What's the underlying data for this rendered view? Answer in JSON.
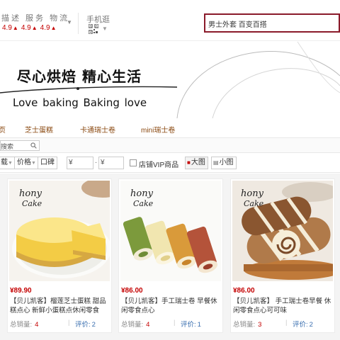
{
  "header": {
    "rating_label": "描述 服务 物流",
    "rating_values": [
      "4.9",
      "4.9",
      "4.9"
    ],
    "mobile_label": "手机逛",
    "search_value": "男士外套 百变百搭"
  },
  "banner": {
    "slogan_cn": "尽心烘焙 精心生活",
    "slogan_en": "Love baking   Baking love"
  },
  "category_nav": [
    "页",
    "芝士蛋糕",
    "卡通瑞士卷",
    "mini瑞士卷"
  ],
  "shop_search": {
    "text": "搜索"
  },
  "sortbar": {
    "sort_sales": "载",
    "sort_price": "价格",
    "sort_reputation": "口碑",
    "price_from": "¥",
    "price_dash": "-",
    "price_to": "¥",
    "vip_label": "店铺VIP商品",
    "view_large": "大图",
    "view_small": "小图"
  },
  "products": [
    {
      "price": "¥89.90",
      "title": "【贝儿凯客】榴莲芝士蛋糕 甜品糕点心 新鲜小蛋糕点休闲零食",
      "sold_label": "总销量:",
      "sold": "4",
      "reviews_label": "评价:",
      "reviews": "2"
    },
    {
      "price": "¥86.00",
      "title": "【贝儿凯客】手工瑞士卷 早餐休闲零食点心",
      "sold_label": "总销量:",
      "sold": "4",
      "reviews_label": "评价:",
      "reviews": "1"
    },
    {
      "price": "¥86.00",
      "title": "【贝儿凯客】 手工瑞士卷早餐 休闲零食点心可可味",
      "sold_label": "总销量:",
      "sold": "3",
      "reviews_label": "评价:",
      "reviews": "2"
    }
  ],
  "colors": {
    "accent_red": "#c40000",
    "search_border": "#8a1a2a",
    "nav_brown": "#8b4a12",
    "link_blue": "#3a6fb0"
  },
  "icons": [
    "qr-code-icon",
    "chevron-down-icon",
    "search-icon",
    "grid-icon",
    "list-icon",
    "checkbox-icon"
  ]
}
